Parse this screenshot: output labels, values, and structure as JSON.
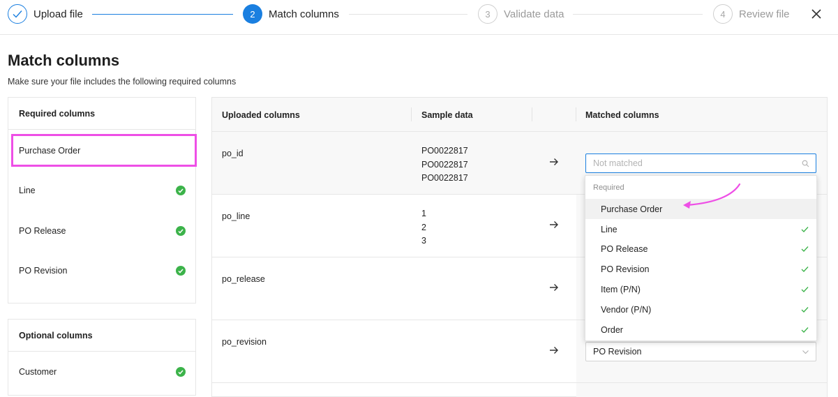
{
  "stepper": {
    "steps": [
      {
        "number": "",
        "label": "Upload file",
        "state": "done"
      },
      {
        "number": "2",
        "label": "Match columns",
        "state": "active"
      },
      {
        "number": "3",
        "label": "Validate data",
        "state": "pending"
      },
      {
        "number": "4",
        "label": "Review file",
        "state": "pending"
      }
    ],
    "close_icon": "close-icon"
  },
  "page": {
    "title": "Match columns",
    "subtitle": "Make sure your file includes the following required columns"
  },
  "required_panel": {
    "header": "Required columns",
    "items": [
      {
        "label": "Purchase Order",
        "matched": false
      },
      {
        "label": "Line",
        "matched": true
      },
      {
        "label": "PO Release",
        "matched": true
      },
      {
        "label": "PO Revision",
        "matched": true
      }
    ]
  },
  "optional_panel": {
    "header": "Optional columns",
    "items": [
      {
        "label": "Customer",
        "matched": true
      }
    ]
  },
  "table": {
    "headers": {
      "uploaded": "Uploaded columns",
      "sample": "Sample data",
      "matched": "Matched columns"
    },
    "rows": [
      {
        "uploaded": "po_id",
        "sample": [
          "PO0022817",
          "PO0022817",
          "PO0022817"
        ],
        "matched": "",
        "placeholder": "Not matched"
      },
      {
        "uploaded": "po_line",
        "sample": [
          "1",
          "2",
          "3"
        ],
        "matched": ""
      },
      {
        "uploaded": "po_release",
        "sample": [],
        "matched": ""
      },
      {
        "uploaded": "po_revision",
        "sample": [],
        "matched": "PO Revision"
      }
    ]
  },
  "dropdown": {
    "group_label": "Required",
    "options": [
      {
        "label": "Purchase Order",
        "checked": false,
        "hovered": true
      },
      {
        "label": "Line",
        "checked": true
      },
      {
        "label": "PO Release",
        "checked": true
      },
      {
        "label": "PO Revision",
        "checked": true
      },
      {
        "label": "Item (P/N)",
        "checked": true
      },
      {
        "label": "Vendor (P/N)",
        "checked": true
      },
      {
        "label": "Order",
        "checked": true
      }
    ]
  },
  "colors": {
    "accent": "#1a7fe0",
    "success": "#3cb34a",
    "annotation": "#ee4fe6"
  }
}
